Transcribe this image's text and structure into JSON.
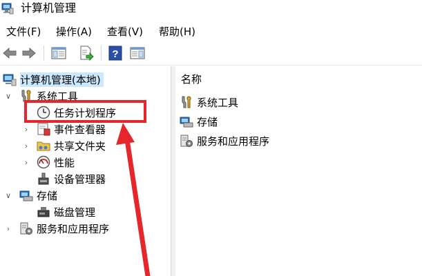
{
  "window": {
    "title": "计算机管理"
  },
  "menu": [
    {
      "label": "文件(F)"
    },
    {
      "label": "操作(A)"
    },
    {
      "label": "查看(V)"
    },
    {
      "label": "帮助(H)"
    }
  ],
  "toolbar": {
    "buttons": [
      "back-icon",
      "forward-icon",
      "show-hide-tree-icon",
      "export-list-icon",
      "help-icon",
      "show-hide-action-pane-icon"
    ]
  },
  "tree": {
    "root": "计算机管理(本地)",
    "system_tools": "系统工具",
    "task_scheduler": "任务计划程序",
    "event_viewer": "事件查看器",
    "shared_folders": "共享文件夹",
    "performance": "性能",
    "device_manager": "设备管理器",
    "storage": "存储",
    "disk_management": "磁盘管理",
    "services_apps": "服务和应用程序"
  },
  "right": {
    "column_header": "名称",
    "items": [
      "系统工具",
      "存储",
      "服务和应用程序"
    ]
  },
  "colors": {
    "selection": "#cce8ff",
    "annotation": "#e5262a"
  }
}
